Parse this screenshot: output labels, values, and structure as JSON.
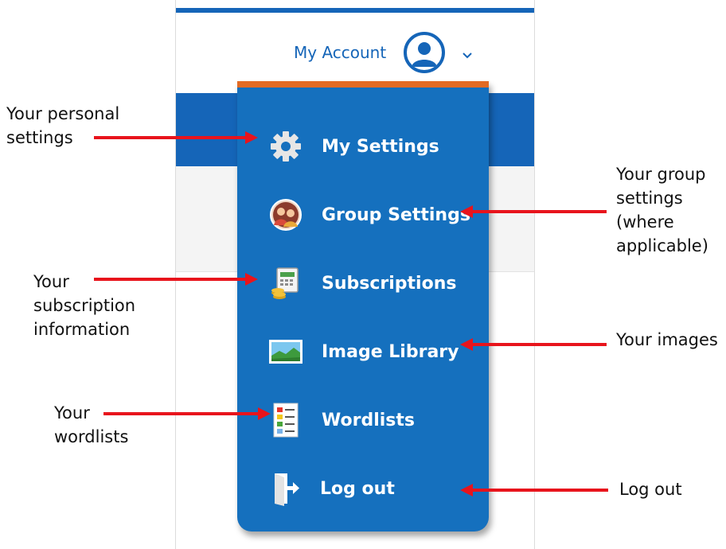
{
  "header": {
    "account_label": "My Account",
    "avatar_icon": "user-avatar-icon",
    "dropdown_icon": "chevron-down-icon"
  },
  "menu": {
    "accent_color": "#e36b24",
    "background_color": "#1570be",
    "items": [
      {
        "label": "My Settings",
        "icon": "gear-icon"
      },
      {
        "label": "Group Settings",
        "icon": "group-avatar-icon"
      },
      {
        "label": "Subscriptions",
        "icon": "subscription-icon"
      },
      {
        "label": "Image Library",
        "icon": "image-icon"
      },
      {
        "label": "Wordlists",
        "icon": "wordlist-icon"
      },
      {
        "label": "Log out",
        "icon": "logout-icon"
      }
    ]
  },
  "annotations": {
    "personal_settings": [
      "Your personal",
      "settings"
    ],
    "group_settings": [
      "Your group",
      "settings",
      "(where",
      "applicable)"
    ],
    "subscription": [
      "Your",
      "subscription",
      "information"
    ],
    "images": [
      "Your images"
    ],
    "wordlists": [
      "Your",
      "wordlists"
    ],
    "logout": [
      "Log out"
    ],
    "arrow_color": "#e8141c"
  }
}
